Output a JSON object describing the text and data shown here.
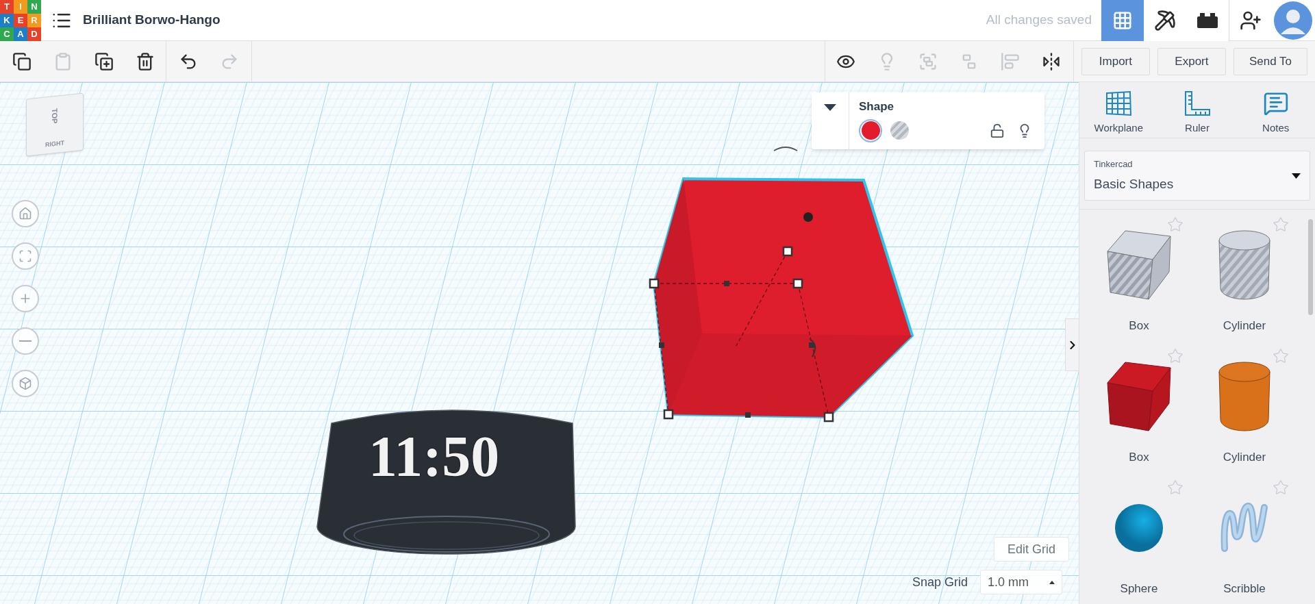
{
  "header": {
    "logo_letters": [
      {
        "letter": "T",
        "color": "#e8412a"
      },
      {
        "letter": "I",
        "color": "#f39a1e"
      },
      {
        "letter": "N",
        "color": "#2fa84f"
      },
      {
        "letter": "K",
        "color": "#1f7fc6"
      },
      {
        "letter": "E",
        "color": "#e8412a"
      },
      {
        "letter": "R",
        "color": "#f39a1e"
      },
      {
        "letter": "C",
        "color": "#2fa84f"
      },
      {
        "letter": "A",
        "color": "#1f7fc6"
      },
      {
        "letter": "D",
        "color": "#e8412a"
      }
    ],
    "title": "Brilliant Borwo-Hango",
    "save_status": "All changes saved",
    "views": [
      {
        "kind": "grid",
        "selected": true
      },
      {
        "kind": "pickaxe",
        "selected": false
      },
      {
        "kind": "bricks",
        "selected": false
      }
    ]
  },
  "toolbar": {
    "tools": [
      {
        "kind": "copy",
        "disabled": false
      },
      {
        "kind": "paste",
        "disabled": true
      },
      {
        "kind": "duplicate",
        "disabled": false
      },
      {
        "kind": "delete",
        "disabled": false
      },
      {
        "kind": "undo",
        "disabled": false
      },
      {
        "kind": "redo",
        "disabled": true
      }
    ],
    "view_tools": [
      {
        "kind": "show",
        "disabled": false
      },
      {
        "kind": "bulb",
        "disabled": true
      },
      {
        "kind": "group",
        "disabled": true
      },
      {
        "kind": "ungroup",
        "disabled": true
      },
      {
        "kind": "align",
        "disabled": true
      },
      {
        "kind": "mirror",
        "disabled": false
      }
    ],
    "buttons": [
      "Import",
      "Export",
      "Send To"
    ]
  },
  "view_cube": {
    "top": "TOP",
    "side": "RIGHT"
  },
  "shape_inspector": {
    "title": "Shape",
    "modes": [
      {
        "kind": "solid",
        "selected": true
      },
      {
        "kind": "hole",
        "selected": false
      }
    ],
    "locked": false
  },
  "model": {
    "text": "11:50"
  },
  "grid_controls": {
    "edit": "Edit Grid",
    "label": "Snap Grid",
    "value": "1.0 mm"
  },
  "panel": {
    "tools": [
      "Workplane",
      "Ruler",
      "Notes"
    ],
    "library": {
      "source": "Tinkercad",
      "name": "Basic Shapes"
    },
    "shapes": [
      {
        "name": "Box",
        "kind": "box-hole",
        "starred": false
      },
      {
        "name": "Cylinder",
        "kind": "cylinder-hole",
        "starred": false
      },
      {
        "name": "Box",
        "kind": "box",
        "starred": false
      },
      {
        "name": "Cylinder",
        "kind": "cylinder",
        "starred": false
      },
      {
        "name": "Sphere",
        "kind": "sphere",
        "starred": false
      },
      {
        "name": "Scribble",
        "kind": "scribble",
        "starred": false
      }
    ]
  }
}
